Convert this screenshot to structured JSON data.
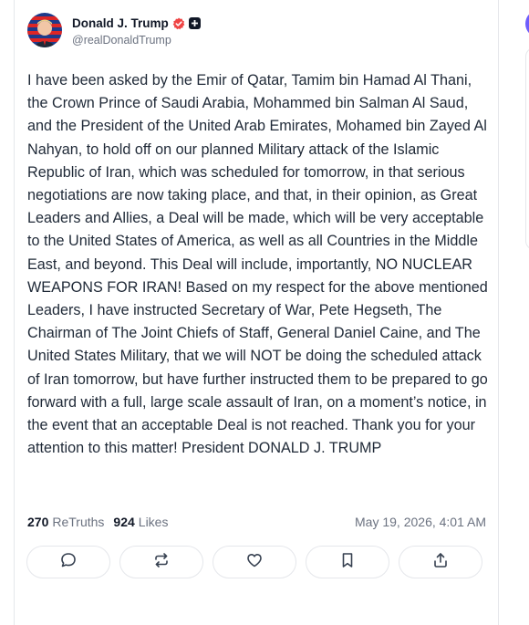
{
  "post": {
    "author_name": "Donald J. Trump",
    "author_handle": "@realDonaldTrump",
    "text": "I have been asked by the Emir of Qatar, Tamim bin Hamad Al Thani, the Crown Prince of Saudi Arabia, Mohammed bin Salman Al Saud, and the President of the United Arab Emirates, Mohamed bin Zayed Al Nahyan, to hold off on our planned Military attack of the Islamic Republic of Iran, which was scheduled for tomorrow, in that serious negotiations are now taking place, and that, in their opinion, as Great Leaders and Allies, a Deal will be made, which will be very acceptable to the United States of America, as well as all Countries in the Middle East, and beyond. This Deal will include, importantly, NO NUCLEAR WEAPONS FOR IRAN! Based on my respect for the above mentioned Leaders, I have instructed Secretary of War, Pete Hegseth, The Chairman of The Joint Chiefs of Staff, General Daniel Caine, and The United States Military, that we will NOT be doing the scheduled attack of Iran tomorrow, but have further instructed them to be prepared to go forward with a full, large scale assault of Iran, on a moment’s notice, in the event that an acceptable Deal is not reached. Thank you for your attention to this matter! President DONALD J. TRUMP",
    "retruths_count": "270",
    "retruths_label": "ReTruths",
    "likes_count": "924",
    "likes_label": "Likes",
    "timestamp": "May 19, 2026, 4:01 AM"
  },
  "icons": {
    "verified": "verified-badge-icon",
    "plus": "plus-badge-icon",
    "reply": "reply-icon",
    "retruth": "retruth-icon",
    "like": "heart-icon",
    "bookmark": "bookmark-icon",
    "share": "share-icon"
  },
  "colors": {
    "verified": "#ef4444",
    "accent": "#6d5dfc",
    "text": "#1f2937",
    "muted": "#6b7280",
    "border": "#e5e7eb"
  }
}
